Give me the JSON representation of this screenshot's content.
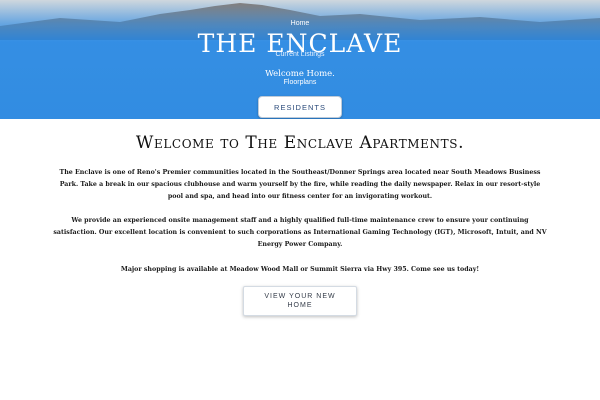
{
  "nav": {
    "home": "Home",
    "current_listings": "Current Listings",
    "floorplans": "Floorplans",
    "residents": "RESIDENTS"
  },
  "hero": {
    "title": "THE ENCLAVE",
    "tagline": "Welcome Home."
  },
  "main": {
    "heading": "Welcome to The Enclave Apartments.",
    "paragraphs": [
      "The Enclave is one of Reno's Premier communities located in the Southeast/Donner Springs area located near South Meadows Business Park.  Take a break in our spacious clubhouse and warm yourself by the fire, while reading the daily newspaper.  Relax in our resort-style pool and spa, and head into our fitness center for an invigorating workout.",
      "We provide an experienced onsite management staff and a highly qualified full-time maintenance crew to ensure your continuing satisfaction. Our excellent location is convenient to such corporations as International Gaming Technology (IGT), Microsoft, Intuit, and NV Energy Power Company.",
      "Major shopping is available at Meadow Wood Mall or Summit Sierra via Hwy 395. Come see us today!"
    ],
    "cta_label": "VIEW YOUR NEW HOME"
  },
  "colors": {
    "hero_blue": "#1f86e5",
    "text_dark": "#111111",
    "button_text": "#2a4a7a"
  }
}
